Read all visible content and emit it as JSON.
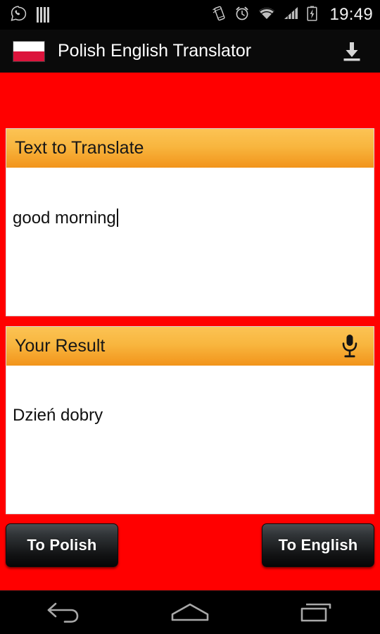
{
  "statusbar": {
    "icons_left": [
      "whatsapp-icon",
      "equalizer-bars-icon"
    ],
    "icons_right": [
      "vibrate-icon",
      "alarm-clock-icon",
      "wifi-icon",
      "signal-bars-icon",
      "battery-charging-icon"
    ],
    "time": "19:49"
  },
  "appbar": {
    "flag_icon": "polish-flag-icon",
    "title": "Polish English Translator",
    "action_icon": "download-icon"
  },
  "colors": {
    "background": "#ff0000",
    "header_gradient_top": "#fcc354",
    "header_gradient_bottom": "#f2941b",
    "flag_red": "#dc143c",
    "button_dark": "#1a1d1f"
  },
  "source_card": {
    "header_title": "Text to Translate",
    "text_value": "good morning",
    "placeholder": ""
  },
  "result_card": {
    "header_title": "Your Result",
    "mic_icon": "microphone-icon",
    "text_value": "Dzień dobry",
    "placeholder": ""
  },
  "buttons": {
    "to_polish": "To Polish",
    "to_english": "To English"
  },
  "navbar": {
    "back": "back-icon",
    "home": "home-icon",
    "recents": "recents-icon"
  }
}
